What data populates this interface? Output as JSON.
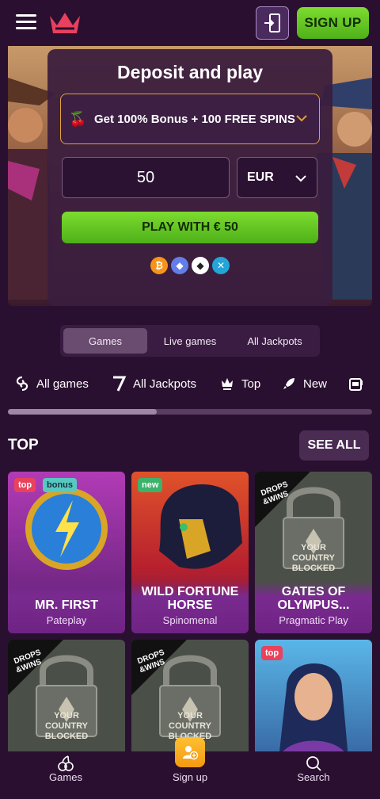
{
  "header": {
    "menu_icon": "hamburger-icon",
    "logo_icon": "crown-logo",
    "login_icon": "login-door-icon",
    "signup_label": "SIGN UP",
    "accent_green": "#5fc720"
  },
  "deposit": {
    "title": "Deposit and play",
    "bonus_text": "Get 100% Bonus + 100 FREE SPINS",
    "amount": "50",
    "currency": "EUR",
    "play_label": "PLAY WITH € 50",
    "crypto_icons": [
      "bitcoin-icon",
      "ethereum-icon",
      "ethereum-classic-icon",
      "ripple-icon"
    ]
  },
  "tabs": [
    {
      "label": "Games",
      "active": true
    },
    {
      "label": "Live games",
      "active": false
    },
    {
      "label": "All Jackpots",
      "active": false
    }
  ],
  "categories": [
    {
      "label": "All games",
      "icon": "swirl-icon"
    },
    {
      "label": "All Jackpots",
      "icon": "seven-icon"
    },
    {
      "label": "Top",
      "icon": "crown-icon"
    },
    {
      "label": "New",
      "icon": "rocket-icon"
    },
    {
      "label": "",
      "icon": "slot-machine-icon"
    }
  ],
  "section": {
    "title": "TOP",
    "see_all_label": "SEE ALL"
  },
  "games": [
    {
      "name": "MR. FIRST",
      "provider": "Pateplay",
      "badges": [
        "top",
        "bonus"
      ]
    },
    {
      "name": "WILD FORTUNE HORSE",
      "provider": "Spinomenal",
      "badges": [
        "new"
      ]
    },
    {
      "name": "GATES OF OLYMPUS...",
      "provider": "Pragmatic Play",
      "badges": [],
      "blocked": "YOUR COUNTRY BLOCKED",
      "drops": "DROPS &WINS"
    },
    {
      "name": "",
      "provider": "",
      "badges": [],
      "blocked": "YOUR COUNTRY BLOCKED",
      "drops": "DROPS &WINS"
    },
    {
      "name": "",
      "provider": "",
      "badges": [],
      "blocked": "YOUR COUNTRY BLOCKED",
      "drops": "DROPS &WINS"
    },
    {
      "name": "",
      "provider": "",
      "badges": [
        "top"
      ]
    }
  ],
  "badge_labels": {
    "top": "top",
    "bonus": "bonus",
    "new": "new"
  },
  "bottom_nav": [
    {
      "label": "Games",
      "icon": "cherries-icon"
    },
    {
      "label": "Sign up",
      "icon": "add-user-icon"
    },
    {
      "label": "Search",
      "icon": "search-icon"
    }
  ]
}
